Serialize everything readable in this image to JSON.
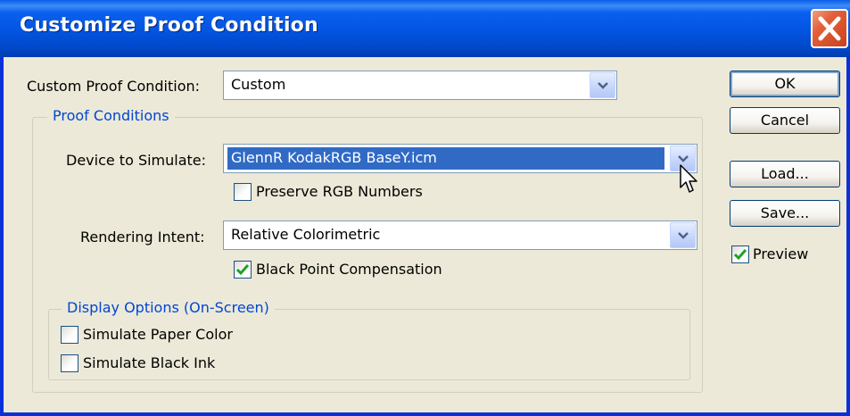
{
  "window": {
    "title": "Customize Proof Condition"
  },
  "custom_condition": {
    "label": "Custom Proof Condition:",
    "value": "Custom"
  },
  "proof_conditions": {
    "legend": "Proof Conditions",
    "device_label": "Device to Simulate:",
    "device_value": "GlennR KodakRGB BaseY.icm",
    "preserve_rgb": {
      "label": "Preserve RGB Numbers",
      "checked": false
    },
    "intent_label": "Rendering Intent:",
    "intent_value": "Relative Colorimetric",
    "black_point": {
      "label": "Black Point Compensation",
      "checked": true
    }
  },
  "display_options": {
    "legend": "Display Options (On-Screen)",
    "paper_color": {
      "label": "Simulate Paper Color",
      "checked": false
    },
    "black_ink": {
      "label": "Simulate Black Ink",
      "checked": false
    }
  },
  "buttons": {
    "ok": "OK",
    "cancel": "Cancel",
    "load": "Load...",
    "save": "Save..."
  },
  "preview": {
    "label": "Preview",
    "checked": true
  },
  "colors": {
    "title_bar": "#0054e3",
    "selection": "#316ac5",
    "legend_text": "#0046d5",
    "check": "#21a121"
  }
}
